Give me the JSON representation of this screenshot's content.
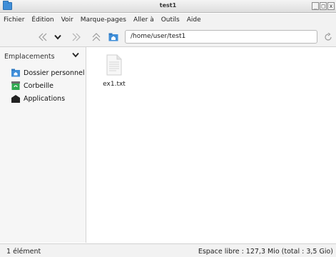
{
  "window": {
    "title": "test1",
    "buttons": [
      "_",
      "□",
      "x"
    ]
  },
  "menubar": {
    "items": [
      "Fichier",
      "Édition",
      "Voir",
      "Marque-pages",
      "Aller à",
      "Outils",
      "Aide"
    ]
  },
  "toolbar": {
    "location": "/home/user/test1",
    "icons": [
      "back-icon",
      "dropdown-chevron-icon",
      "forward-icon",
      "parent-folder-icon",
      "home-folder-icon",
      "reload-icon"
    ]
  },
  "sidebar": {
    "header": "Emplacements",
    "items": [
      {
        "label": "Dossier personnel",
        "icon": "home-folder-icon"
      },
      {
        "label": "Corbeille",
        "icon": "trash-icon"
      },
      {
        "label": "Applications",
        "icon": "applications-icon"
      }
    ]
  },
  "files": [
    {
      "name": "ex1.txt",
      "icon": "text-file-icon"
    }
  ],
  "statusbar": {
    "count": "1 élément",
    "free_space": "Espace libre : 127,3 Mio (total : 3,5 Gio)"
  },
  "colors": {
    "accent": "#3f8ed8",
    "trash": "#2fa84f"
  }
}
